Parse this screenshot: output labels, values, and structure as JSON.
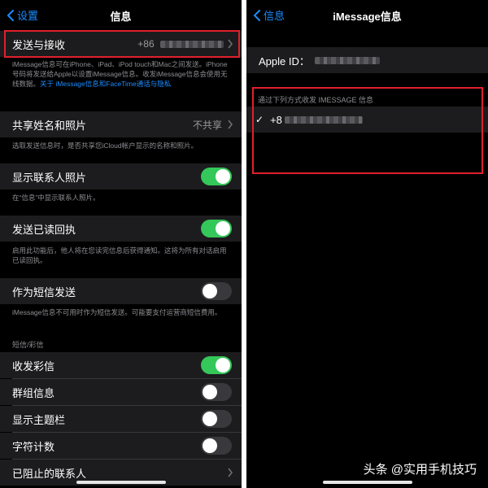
{
  "left": {
    "nav": {
      "back_label": "设置",
      "title": "信息"
    },
    "send_receive": {
      "label": "发送与接收",
      "value": "+86"
    },
    "imessage_footer": "iMessage信息可在iPhone、iPad、iPod touch和Mac之间发送。iPhone号码将发送给Apple以设置iMessage信息。收发iMessage信息会使用无线数据。",
    "imessage_footer_link": "关于 iMessage信息和FaceTime通话与隐私",
    "share_name": {
      "label": "共享姓名和照片",
      "value": "不共享"
    },
    "share_footer": "选取发送信息时，是否共享您iCloud帐户显示的名称和照片。",
    "show_contact_photos": {
      "label": "显示联系人照片",
      "on": true
    },
    "show_contact_photos_footer": "在“信息”中显示联系人照片。",
    "read_receipts": {
      "label": "发送已读回执",
      "on": true
    },
    "read_receipts_footer": "启用此功能后，他人将在您读完信息后获得通知。这将为所有对话启用已读回执。",
    "send_as_sms": {
      "label": "作为短信发送",
      "on": false
    },
    "send_as_sms_footer": "iMessage信息不可用时作为短信发送。可能要支付运营商短信费用。",
    "sms_section_header": "短信/彩信",
    "mms": {
      "label": "收发彩信",
      "on": true
    },
    "group": {
      "label": "群组信息",
      "on": false
    },
    "subject": {
      "label": "显示主题栏",
      "on": false
    },
    "char_count": {
      "label": "字符计数",
      "on": false
    },
    "blocked": {
      "label": "已阻止的联系人"
    }
  },
  "right": {
    "nav": {
      "back_label": "信息",
      "title": "iMessage信息"
    },
    "apple_id_label": "Apple ID：",
    "section_header": "通过下列方式收发 IMESSAGE 信息",
    "number_prefix": "+8",
    "checkmark": "✓"
  },
  "watermark": "头条 @实用手机技巧",
  "colors": {
    "accent": "#1a8cff",
    "switch_on": "#34c759",
    "highlight_box": "#e0202c",
    "cell_bg": "#1c1c1e"
  },
  "icons": [
    "chevron-left-icon",
    "chevron-right-icon",
    "checkmark-icon"
  ]
}
